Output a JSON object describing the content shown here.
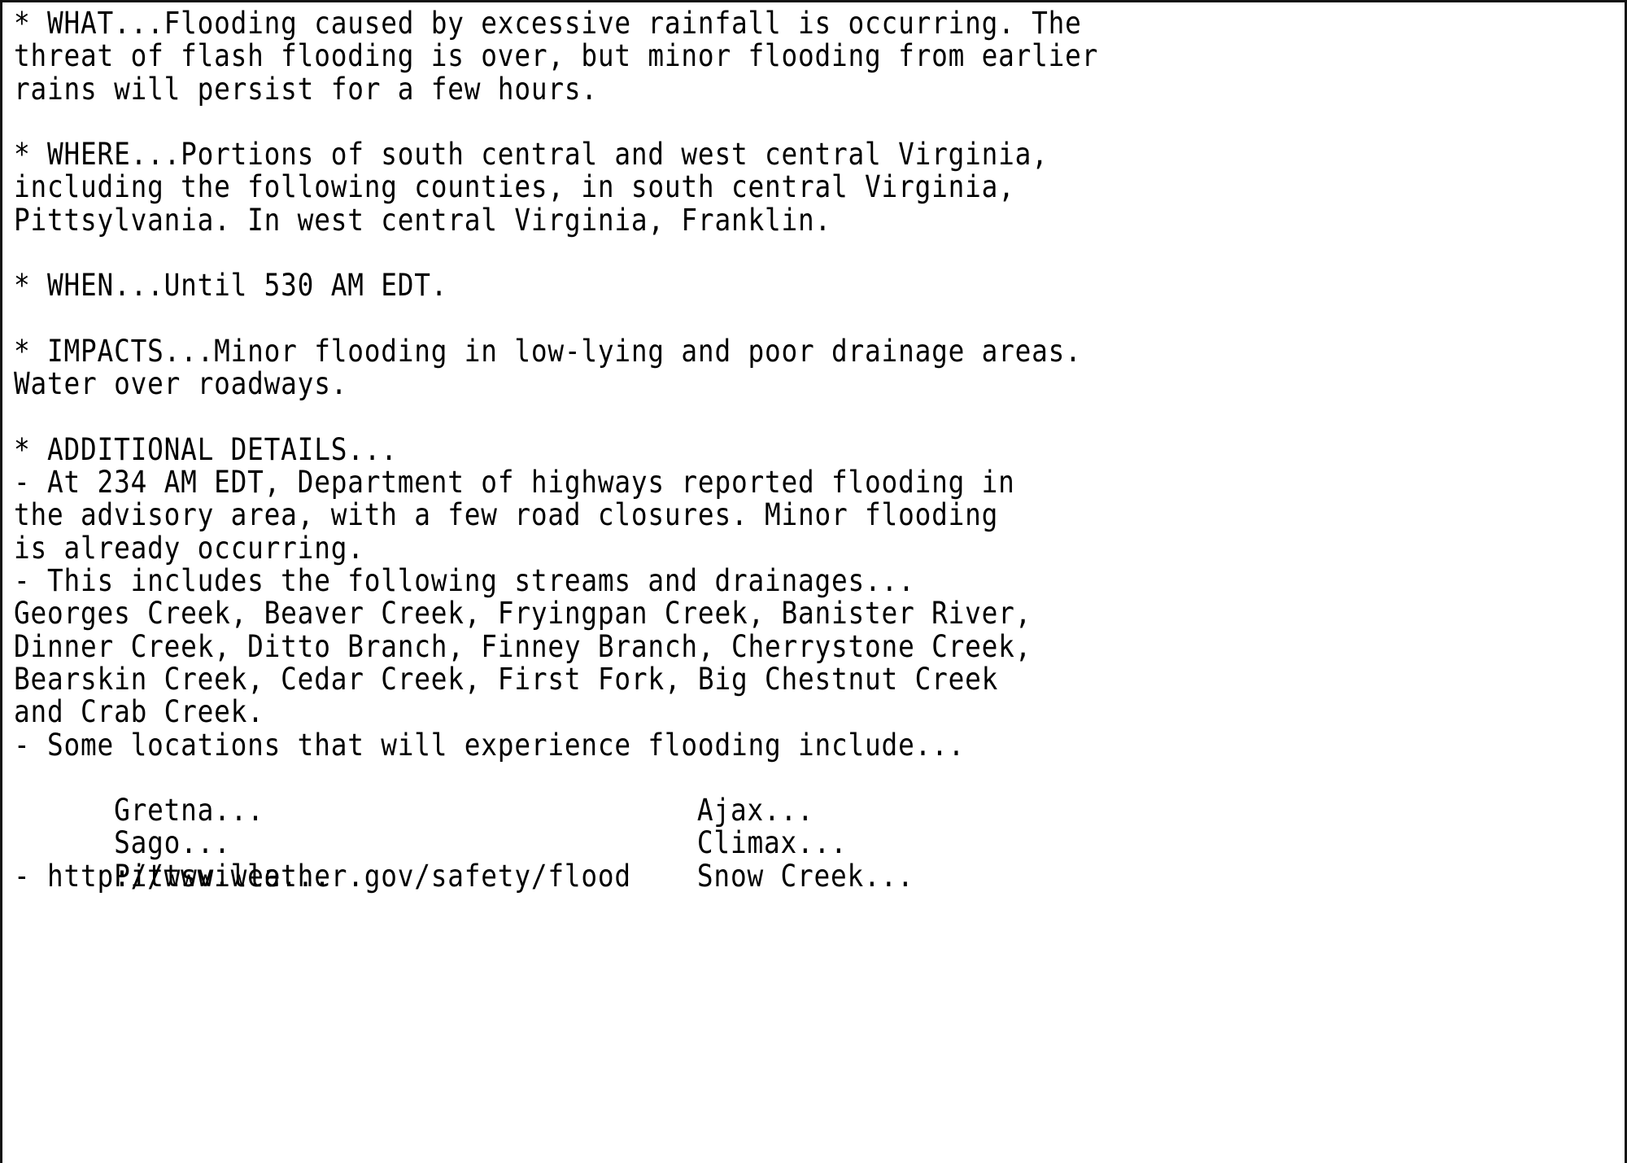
{
  "document": {
    "kind": "nws-flood-advisory-text",
    "background_color": "#ffffff",
    "text_color": "#000000",
    "border_color": "#111111"
  },
  "sections": {
    "what": {
      "lines": [
        "* WHAT...Flooding caused by excessive rainfall is occurring. The",
        "threat of flash flooding is over, but minor flooding from earlier",
        "rains will persist for a few hours."
      ]
    },
    "where": {
      "lines": [
        "* WHERE...Portions of south central and west central Virginia,",
        "including the following counties, in south central Virginia,",
        "Pittsylvania. In west central Virginia, Franklin."
      ]
    },
    "when": {
      "lines": [
        "* WHEN...Until 530 AM EDT."
      ]
    },
    "impacts": {
      "lines": [
        "* IMPACTS...Minor flooding in low-lying and poor drainage areas.",
        "Water over roadways."
      ]
    },
    "additional_details": {
      "heading": "* ADDITIONAL DETAILS...",
      "lines": [
        "- At 234 AM EDT, Department of highways reported flooding in",
        "the advisory area, with a few road closures. Minor flooding",
        "is already occurring.",
        "- This includes the following streams and drainages...",
        "Georges Creek, Beaver Creek, Fryingpan Creek, Banister River,",
        "Dinner Creek, Ditto Branch, Finney Branch, Cherrystone Creek,",
        "Bearskin Creek, Cedar Creek, First Fork, Big Chestnut Creek",
        "and Crab Creek.",
        "- Some locations that will experience flooding include..."
      ],
      "locations": [
        {
          "left": "Gretna...",
          "right": "Ajax..."
        },
        {
          "left": "Sago...",
          "right": "Climax..."
        },
        {
          "left": "Pittsville...",
          "right": "Snow Creek..."
        }
      ],
      "safety_link_line": "- http://www.weather.gov/safety/flood"
    }
  }
}
